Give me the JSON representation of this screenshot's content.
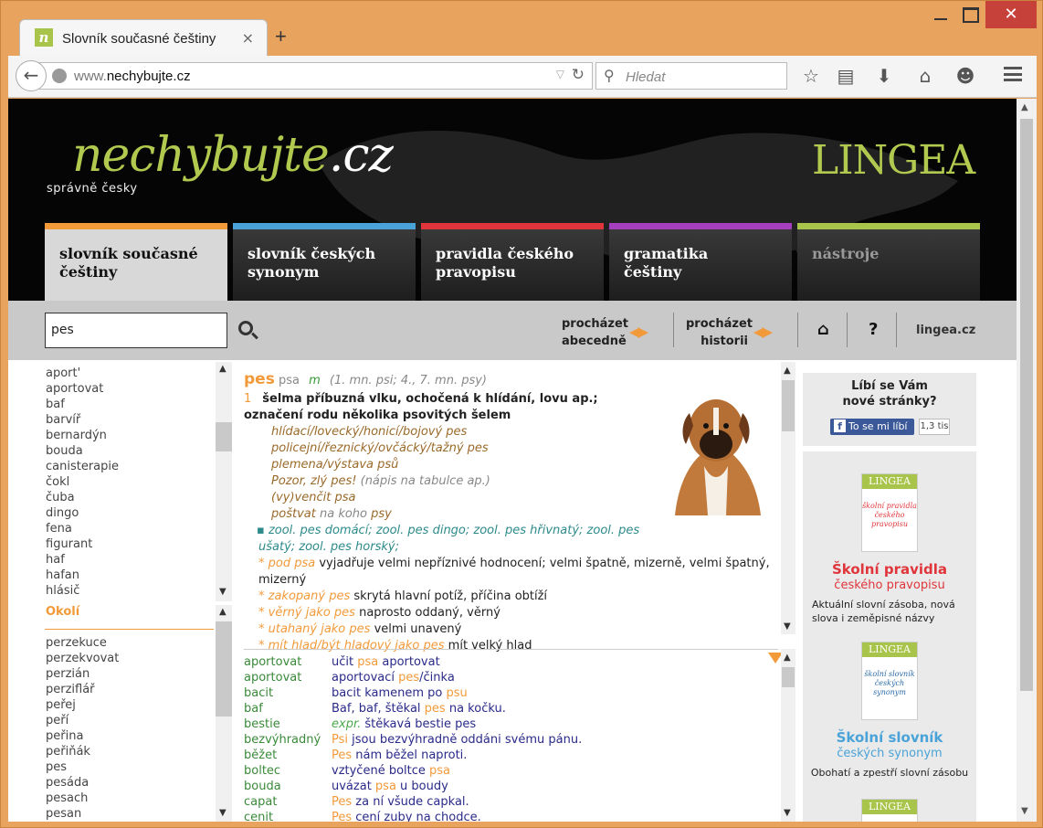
{
  "browser": {
    "tab_title": "Slovník současné češtiny",
    "tab_favicon": "n",
    "url_plain": "www.",
    "url_domain": "nechybujte.cz",
    "search_placeholder": "Hledat",
    "close_button": "✕"
  },
  "header": {
    "logo_main": "nechybujte",
    "logo_tld": ".cz",
    "tagline": "správně česky",
    "brand": "LINGEA"
  },
  "nav_tabs": [
    {
      "label": "slovník současné češtiny",
      "color": "#f29a3a"
    },
    {
      "label": "slovník českých synonym",
      "color": "#4aa3d8"
    },
    {
      "label": "pravidla českého pravopisu",
      "color": "#e0353b"
    },
    {
      "label": "gramatika češtiny",
      "color": "#a63ec0"
    },
    {
      "label": "nástroje",
      "color": "#a9c44a"
    }
  ],
  "toolbar": {
    "search_value": "pes",
    "browse_alpha_l1": "procházet",
    "browse_alpha_l2": "abecedně",
    "browse_hist_l1": "procházet",
    "browse_hist_l2": "historii",
    "help": "?",
    "lingea_link": "lingea.cz"
  },
  "word_list": [
    "aport'",
    "aportovat",
    "baf",
    "barvíř",
    "bernardýn",
    "bouda",
    "canisterapie",
    "čokl",
    "čuba",
    "dingo",
    "fena",
    "figurant",
    "haf",
    "hafan",
    "hlásič"
  ],
  "okoli_label": "Okolí",
  "okoli_list": [
    "perzekuce",
    "perzekvovat",
    "perzián",
    "perziflář",
    "peřej",
    "peří",
    "peřina",
    "peřiňák",
    "pes",
    "pesáda",
    "pesach",
    "pesan"
  ],
  "entry": {
    "headword": "pes",
    "gen": "psa",
    "gender": "m",
    "forms": "(1. mn. psi; 4., 7. mn. psy)",
    "sense_num": "1",
    "definition": "šelma příbuzná vlku, ochočená k hlídání, lovu ap.; označení rodu několika psovitých šelem",
    "examples": [
      "hlídací/lovecký/honicí/bojový pes",
      "policejní/řeznický/ovčácký/tažný pes",
      "plemena/výstava psů"
    ],
    "ex_pozor": "Pozor, zlý pes!",
    "ex_pozor_note": "(nápis na tabulce ap.)",
    "ex_vencit": "(vy)venčit psa",
    "ex_postvat": "poštvat",
    "ex_postvat_mid": "na koho",
    "ex_postvat_end": "psy",
    "zool_line": "▪ zool. pes domácí; zool. pes dingo; zool. pes hřivnatý; zool. pes ušatý; zool. pes horský;",
    "idioms": [
      {
        "phrase": "* pod psa",
        "meaning": "vyjadřuje velmi nepříznivé hodnocení; velmi špatně, mizerně, velmi špatný, mizerný"
      },
      {
        "phrase": "* zakopaný pes",
        "meaning": "skrytá hlavní potíž, příčina obtíží"
      },
      {
        "phrase": "* věrný jako pes",
        "meaning": "naprosto oddaný, věrný"
      },
      {
        "phrase": "* utahaný jako pes",
        "meaning": "velmi unavený"
      },
      {
        "phrase": "* mít hlad/být hladový jako pes",
        "meaning": "mít velký hlad"
      }
    ]
  },
  "related": [
    {
      "word": "aportovat",
      "pre": "učit ",
      "hl": "psa",
      "post": " aportovat"
    },
    {
      "word": "aportovat",
      "pre": "aportovací ",
      "hl": "pes",
      "post": "/činka"
    },
    {
      "word": "bacit",
      "pre": "bacit kamenem po ",
      "hl": "psu",
      "post": ""
    },
    {
      "word": "baf",
      "pre": "Baf, baf, štěkal ",
      "hl": "pes",
      "post": " na kočku."
    },
    {
      "word": "bestie",
      "pre": "expr.",
      "hl": "",
      "post": " štěkavá bestie pes"
    },
    {
      "word": "bezvýhradný",
      "pre": "",
      "hl": "Psi",
      "post": " jsou bezvýhradně oddáni svému pánu."
    },
    {
      "word": "běžet",
      "pre": "",
      "hl": "Pes",
      "post": " nám běžel naproti."
    },
    {
      "word": "boltec",
      "pre": "vztyčené boltce ",
      "hl": "psa",
      "post": ""
    },
    {
      "word": "bouda",
      "pre": "uvázat ",
      "hl": "psa",
      "post": " u boudy"
    },
    {
      "word": "capat",
      "pre": "",
      "hl": "Pes",
      "post": " za ní všude capkal."
    },
    {
      "word": "cenit",
      "pre": "",
      "hl": "Pes",
      "post": " cení zuby na chodce."
    }
  ],
  "sidebar": {
    "fb_question_l1": "Líbí se Vám",
    "fb_question_l2": "nové stránky?",
    "fb_like": "To se mi líbí",
    "fb_count": "1,3 tis",
    "promo1_title": "Školní pravidla",
    "promo1_sub": "českého pravopisu",
    "promo1_desc": "Aktuální slovní zásoba, nová slova i zeměpisné názvy",
    "promo1_color": "#e0353b",
    "promo2_title": "Školní slovník",
    "promo2_sub": "českých synonym",
    "promo2_desc": "Obohatí a zpestří slovní zásobu",
    "promo2_color": "#4aa3d8",
    "book_brand": "LINGEA",
    "book1_text": "školní pravidla českého pravopisu",
    "book2_text": "školní slovník českých synonym"
  }
}
